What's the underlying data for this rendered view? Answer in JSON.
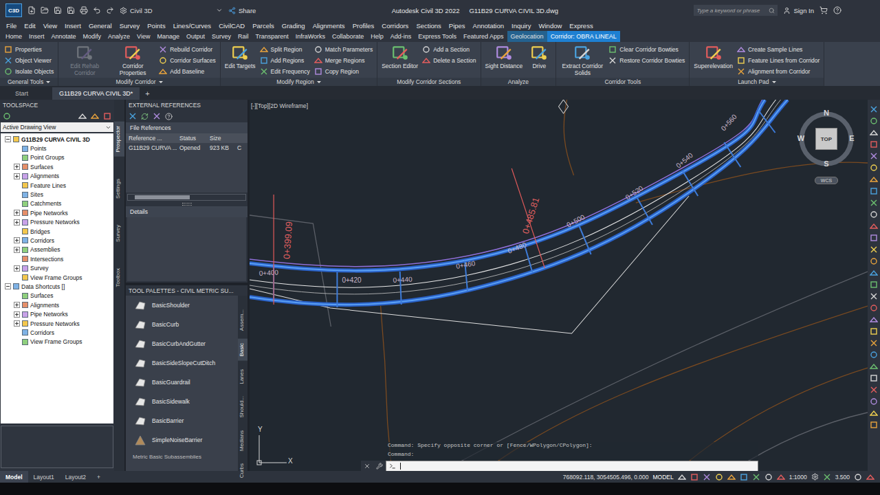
{
  "window": {
    "app_logo": "C3D",
    "title_app": "Autodesk Civil 3D 2022",
    "title_file": "G11B29 CURVA CIVIL 3D.dwg",
    "workspace": "Civil 3D",
    "share": "Share",
    "search_placeholder": "Type a keyword or phrase",
    "sign_in": "Sign In"
  },
  "menu": [
    "File",
    "Edit",
    "View",
    "Insert",
    "General",
    "Survey",
    "Points",
    "Lines/Curves",
    "CivilCAD",
    "Parcels",
    "Grading",
    "Alignments",
    "Profiles",
    "Corridors",
    "Sections",
    "Pipes",
    "Annotation",
    "Inquiry",
    "Window",
    "Express"
  ],
  "ribbon_tabs": [
    {
      "label": "Home",
      "selected": false,
      "kind": "normal"
    },
    {
      "label": "Insert",
      "selected": false,
      "kind": "normal"
    },
    {
      "label": "Annotate",
      "selected": false,
      "kind": "normal"
    },
    {
      "label": "Modify",
      "selected": false,
      "kind": "normal"
    },
    {
      "label": "Analyze",
      "selected": false,
      "kind": "normal"
    },
    {
      "label": "View",
      "selected": false,
      "kind": "normal"
    },
    {
      "label": "Manage",
      "selected": false,
      "kind": "normal"
    },
    {
      "label": "Output",
      "selected": false,
      "kind": "normal"
    },
    {
      "label": "Survey",
      "selected": false,
      "kind": "normal"
    },
    {
      "label": "Rail",
      "selected": false,
      "kind": "normal"
    },
    {
      "label": "Transparent",
      "selected": false,
      "kind": "normal"
    },
    {
      "label": "InfraWorks",
      "selected": false,
      "kind": "normal"
    },
    {
      "label": "Collaborate",
      "selected": false,
      "kind": "normal"
    },
    {
      "label": "Help",
      "selected": false,
      "kind": "normal"
    },
    {
      "label": "Add-ins",
      "selected": false,
      "kind": "normal"
    },
    {
      "label": "Express Tools",
      "selected": false,
      "kind": "normal"
    },
    {
      "label": "Featured Apps",
      "selected": false,
      "kind": "normal"
    },
    {
      "label": "Geolocation",
      "selected": false,
      "kind": "contextual"
    },
    {
      "label": "Corridor: OBRA LINEAL",
      "selected": true,
      "kind": "contextual"
    }
  ],
  "ribbon_groups": [
    {
      "label": "General Tools",
      "has_menu": true,
      "items": [
        {
          "label": "Properties",
          "kind": "small",
          "disabled": false
        },
        {
          "label": "Object Viewer",
          "kind": "small",
          "disabled": false
        },
        {
          "label": "Isolate Objects",
          "kind": "small",
          "disabled": false
        }
      ]
    },
    {
      "label": "Modify Corridor",
      "has_menu": true,
      "items": [
        {
          "label": "Edit Rehab Corridor",
          "kind": "large",
          "disabled": true
        },
        {
          "label": "Corridor Properties",
          "kind": "large",
          "disabled": false
        },
        {
          "label": "Rebuild Corridor",
          "kind": "small",
          "disabled": false
        },
        {
          "label": "Corridor Surfaces",
          "kind": "small",
          "disabled": false
        },
        {
          "label": "Add Baseline",
          "kind": "small",
          "disabled": false
        }
      ]
    },
    {
      "label": "Modify Region",
      "has_menu": true,
      "items": [
        {
          "label": "Edit Targets",
          "kind": "large",
          "disabled": false
        },
        {
          "label": "Split Region",
          "kind": "small",
          "disabled": false
        },
        {
          "label": "Add Regions",
          "kind": "small",
          "disabled": false
        },
        {
          "label": "Edit Frequency",
          "kind": "small",
          "disabled": false
        },
        {
          "label": "Match Parameters",
          "kind": "small",
          "disabled": false
        },
        {
          "label": "Merge Regions",
          "kind": "small",
          "disabled": false
        },
        {
          "label": "Copy Region",
          "kind": "small",
          "disabled": false
        }
      ]
    },
    {
      "label": "Modify Corridor Sections",
      "has_menu": false,
      "items": [
        {
          "label": "Section Editor",
          "kind": "large",
          "disabled": false
        },
        {
          "label": "Add a Section",
          "kind": "small",
          "disabled": false
        },
        {
          "label": "Delete a Section",
          "kind": "small",
          "disabled": false
        }
      ]
    },
    {
      "label": "Analyze",
      "has_menu": false,
      "items": [
        {
          "label": "Sight Distance",
          "kind": "large",
          "disabled": false
        },
        {
          "label": "Drive",
          "kind": "large",
          "disabled": false
        }
      ]
    },
    {
      "label": "Corridor Tools",
      "has_menu": false,
      "items": [
        {
          "label": "Extract Corridor Solids",
          "kind": "large",
          "disabled": false
        },
        {
          "label": "Clear Corridor Bowties",
          "kind": "small",
          "disabled": false
        },
        {
          "label": "Restore Corridor Bowties",
          "kind": "small",
          "disabled": false
        }
      ]
    },
    {
      "label": "Launch Pad",
      "has_menu": true,
      "items": [
        {
          "label": "Superelevation",
          "kind": "large",
          "disabled": false
        },
        {
          "label": "Create Sample Lines",
          "kind": "small",
          "disabled": false
        },
        {
          "label": "Feature Lines from Corridor",
          "kind": "small",
          "disabled": false
        },
        {
          "label": "Alignment from Corridor",
          "kind": "small",
          "disabled": false
        }
      ]
    }
  ],
  "doc_tabs": [
    {
      "label": "Start",
      "selected": false
    },
    {
      "label": "G11B29 CURVA CIVIL 3D*",
      "selected": true
    }
  ],
  "doc_tab_add": "+",
  "toolspace": {
    "title": "TOOLSPACE",
    "view_select": "Active Drawing View",
    "side_tabs": [
      {
        "label": "Prospector",
        "selected": true
      },
      {
        "label": "Settings",
        "selected": false
      },
      {
        "label": "Survey",
        "selected": false
      },
      {
        "label": "Toolbox",
        "selected": false
      }
    ],
    "tree": [
      {
        "label": "G11B29 CURVA CIVIL 3D",
        "depth": 0,
        "kind": "root",
        "has_children": true,
        "expanded": true
      },
      {
        "label": "Points",
        "depth": 1,
        "kind": "item",
        "has_children": false,
        "expanded": false
      },
      {
        "label": "Point Groups",
        "depth": 1,
        "kind": "item",
        "has_children": false,
        "expanded": false
      },
      {
        "label": "Surfaces",
        "depth": 1,
        "kind": "item",
        "has_children": true,
        "expanded": false
      },
      {
        "label": "Alignments",
        "depth": 1,
        "kind": "item",
        "has_children": true,
        "expanded": false
      },
      {
        "label": "Feature Lines",
        "depth": 1,
        "kind": "item",
        "has_children": false,
        "expanded": false
      },
      {
        "label": "Sites",
        "depth": 1,
        "kind": "item",
        "has_children": false,
        "expanded": false
      },
      {
        "label": "Catchments",
        "depth": 1,
        "kind": "item",
        "has_children": false,
        "expanded": false
      },
      {
        "label": "Pipe Networks",
        "depth": 1,
        "kind": "item",
        "has_children": true,
        "expanded": false
      },
      {
        "label": "Pressure Networks",
        "depth": 1,
        "kind": "item",
        "has_children": true,
        "expanded": false
      },
      {
        "label": "Bridges",
        "depth": 1,
        "kind": "item",
        "has_children": false,
        "expanded": false
      },
      {
        "label": "Corridors",
        "depth": 1,
        "kind": "item",
        "has_children": true,
        "expanded": false
      },
      {
        "label": "Assemblies",
        "depth": 1,
        "kind": "item",
        "has_children": true,
        "expanded": false
      },
      {
        "label": "Intersections",
        "depth": 1,
        "kind": "item",
        "has_children": false,
        "expanded": false
      },
      {
        "label": "Survey",
        "depth": 1,
        "kind": "item",
        "has_children": true,
        "expanded": false
      },
      {
        "label": "View Frame Groups",
        "depth": 1,
        "kind": "item",
        "has_children": false,
        "expanded": false
      },
      {
        "label": "Data Shortcuts []",
        "depth": 0,
        "kind": "item",
        "has_children": true,
        "expanded": true
      },
      {
        "label": "Surfaces",
        "depth": 1,
        "kind": "item",
        "has_children": false,
        "expanded": false
      },
      {
        "label": "Alignments",
        "depth": 1,
        "kind": "item",
        "has_children": true,
        "expanded": false
      },
      {
        "label": "Pipe Networks",
        "depth": 1,
        "kind": "item",
        "has_children": true,
        "expanded": false
      },
      {
        "label": "Pressure Networks",
        "depth": 1,
        "kind": "item",
        "has_children": true,
        "expanded": false
      },
      {
        "label": "Corridors",
        "depth": 1,
        "kind": "item",
        "has_children": false,
        "expanded": false
      },
      {
        "label": "View Frame Groups",
        "depth": 1,
        "kind": "item",
        "has_children": false,
        "expanded": false
      }
    ]
  },
  "xref": {
    "title": "EXTERNAL REFERENCES",
    "section": "File References",
    "columns": [
      "Reference ...",
      "Status",
      "Size"
    ],
    "rows": [
      [
        "G11B29 CURVA ...",
        "Opened",
        "923 KB",
        "C"
      ]
    ],
    "details": "Details"
  },
  "palettes": {
    "title": "TOOL PALETTES - CIVIL METRIC SU...",
    "items": [
      "BasicShoulder",
      "BasicCurb",
      "BasicCurbAndGutter",
      "BasicSideSlopeCutDitch",
      "BasicGuardrail",
      "BasicSidewalk",
      "BasicBarrier",
      "SimpleNoiseBarrier"
    ],
    "footer": "Metric Basic Subassemblies",
    "side_tabs": [
      {
        "label": "Assem...",
        "selected": false
      },
      {
        "label": "Basic",
        "selected": true
      },
      {
        "label": "Lanes",
        "selected": false
      },
      {
        "label": "Should...",
        "selected": false
      },
      {
        "label": "Medians",
        "selected": false
      },
      {
        "label": "Curbs",
        "selected": false
      }
    ]
  },
  "canvas": {
    "view_label": "[-][Top][2D Wireframe]",
    "stations": [
      "0+399.09",
      "0+485.81"
    ],
    "chainages": [
      "0+400",
      "0+420",
      "0+440",
      "0+460",
      "0+480",
      "0+500",
      "0+520",
      "0+540",
      "0+560"
    ],
    "viewcube": {
      "north": "N",
      "south": "S",
      "east": "E",
      "west": "W",
      "face": "TOP",
      "ucs": "WCS"
    },
    "ucs_axes": {
      "x": "X",
      "y": "Y"
    }
  },
  "command": {
    "history": [
      "Command: Specify opposite corner or [Fence/WPolygon/CPolygon]:",
      "Command:"
    ],
    "input": ""
  },
  "status": {
    "layout_tabs": [
      {
        "label": "Model",
        "selected": true
      },
      {
        "label": "Layout1",
        "selected": false
      },
      {
        "label": "Layout2",
        "selected": false
      }
    ],
    "add": "+",
    "coordinates": "768092.118, 3054505.496, 0.000",
    "space": "MODEL",
    "scale": "1:1000",
    "annotation_value": "3.500"
  }
}
